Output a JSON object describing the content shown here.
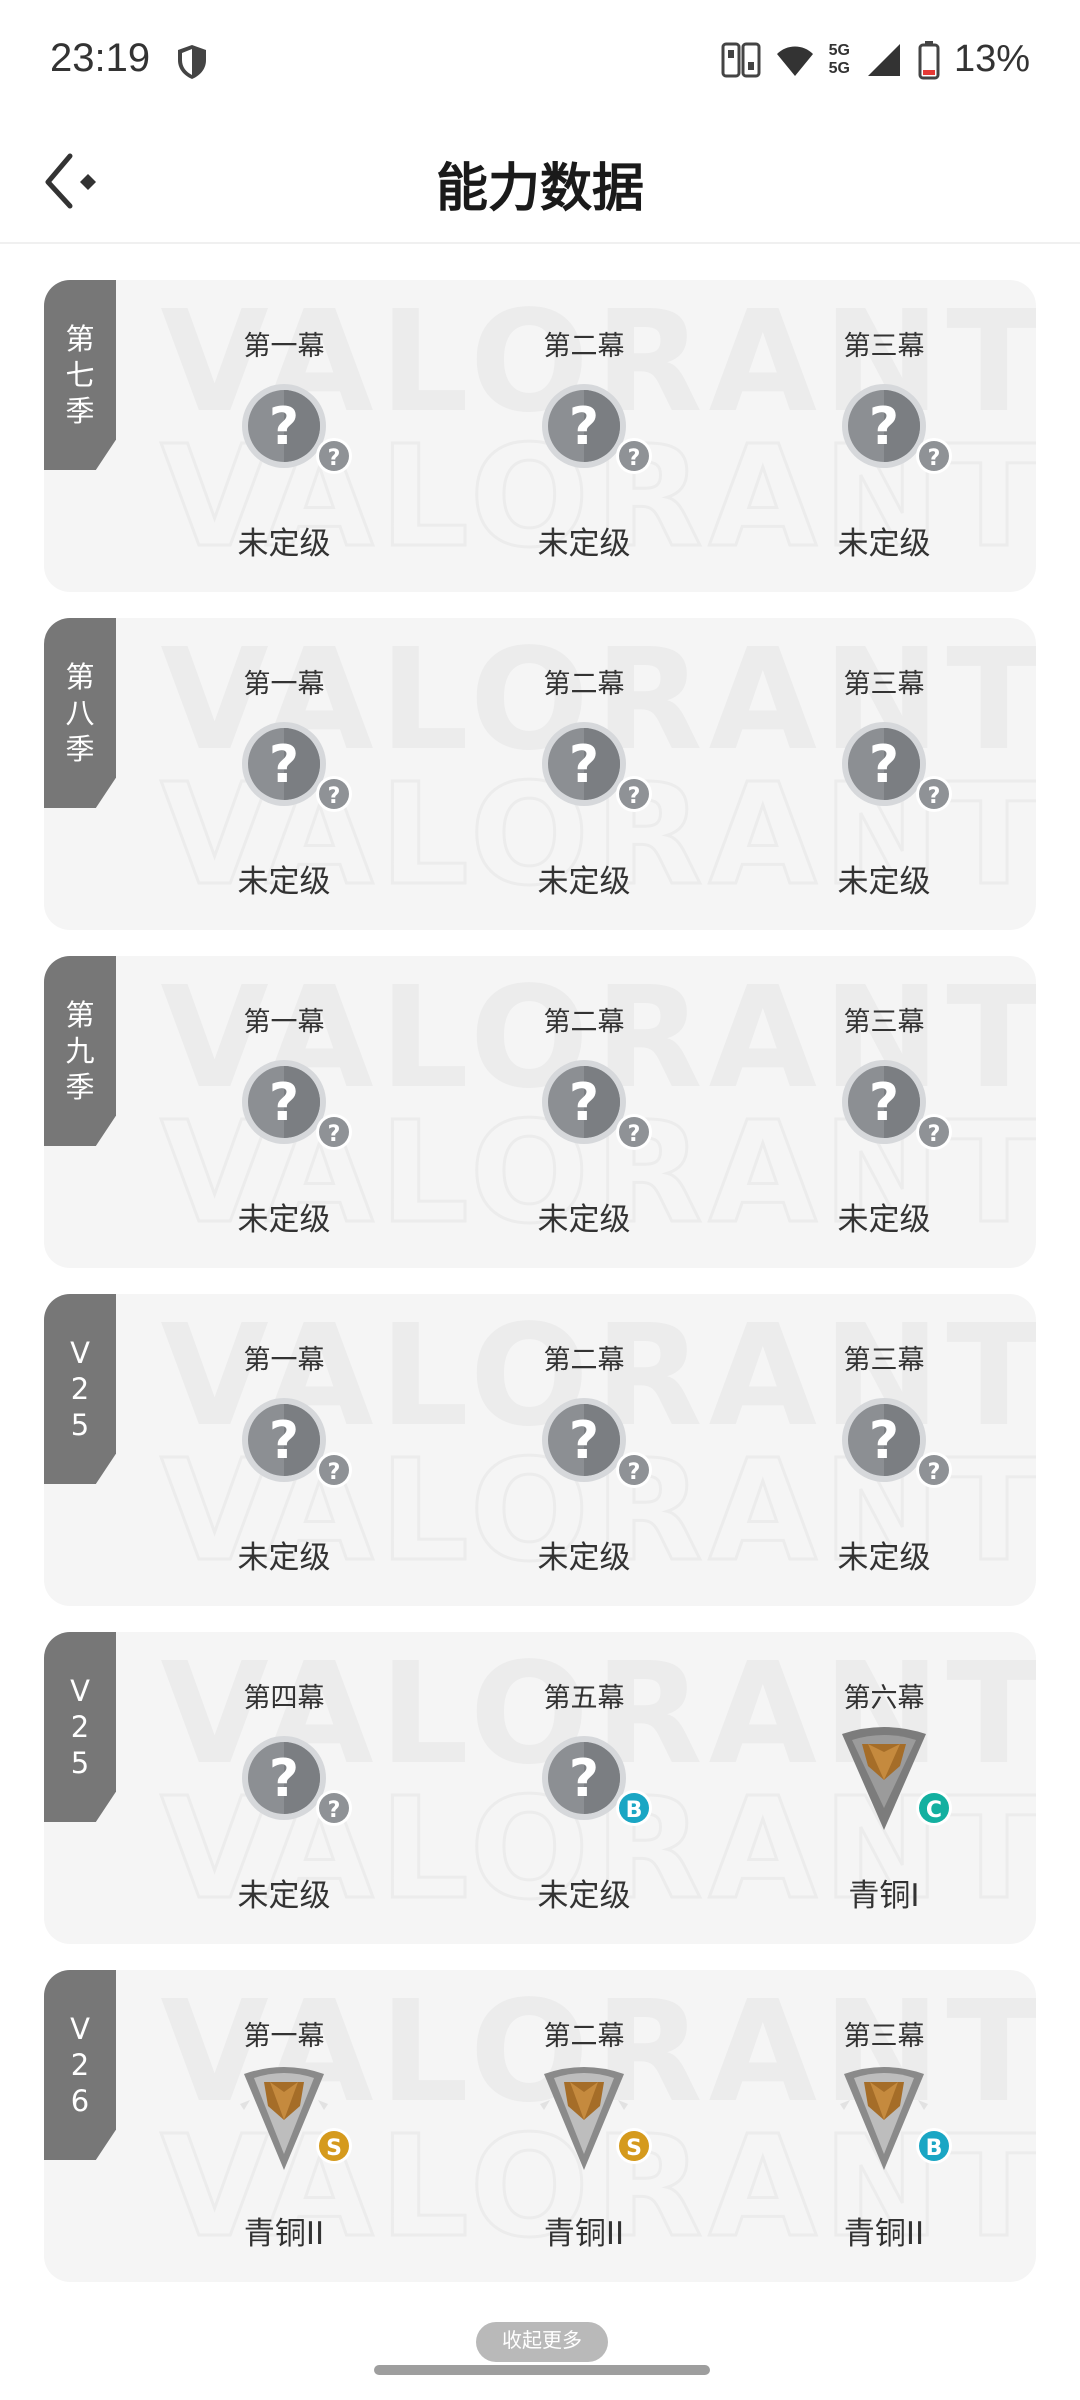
{
  "status_bar": {
    "time": "23:19",
    "network": "5G",
    "battery": "13%",
    "icons": [
      "shield-icon",
      "hd-icon",
      "wifi-icon",
      "signal-icon",
      "battery-icon"
    ]
  },
  "header": {
    "title": "能力数据",
    "back_icon": "back-arrow-icon"
  },
  "watermark_text": "VALORANT",
  "seasons": [
    {
      "tag": "第七季",
      "acts": [
        {
          "name": "第一幕",
          "rank": "未定级",
          "icon": "unranked",
          "grade": "?"
        },
        {
          "name": "第二幕",
          "rank": "未定级",
          "icon": "unranked",
          "grade": "?"
        },
        {
          "name": "第三幕",
          "rank": "未定级",
          "icon": "unranked",
          "grade": "?"
        }
      ]
    },
    {
      "tag": "第八季",
      "acts": [
        {
          "name": "第一幕",
          "rank": "未定级",
          "icon": "unranked",
          "grade": "?"
        },
        {
          "name": "第二幕",
          "rank": "未定级",
          "icon": "unranked",
          "grade": "?"
        },
        {
          "name": "第三幕",
          "rank": "未定级",
          "icon": "unranked",
          "grade": "?"
        }
      ]
    },
    {
      "tag": "第九季",
      "acts": [
        {
          "name": "第一幕",
          "rank": "未定级",
          "icon": "unranked",
          "grade": "?"
        },
        {
          "name": "第二幕",
          "rank": "未定级",
          "icon": "unranked",
          "grade": "?"
        },
        {
          "name": "第三幕",
          "rank": "未定级",
          "icon": "unranked",
          "grade": "?"
        }
      ]
    },
    {
      "tag": "V25",
      "acts": [
        {
          "name": "第一幕",
          "rank": "未定级",
          "icon": "unranked",
          "grade": "?"
        },
        {
          "name": "第二幕",
          "rank": "未定级",
          "icon": "unranked",
          "grade": "?"
        },
        {
          "name": "第三幕",
          "rank": "未定级",
          "icon": "unranked",
          "grade": "?"
        }
      ]
    },
    {
      "tag": "V25",
      "acts": [
        {
          "name": "第四幕",
          "rank": "未定级",
          "icon": "unranked",
          "grade": "?"
        },
        {
          "name": "第五幕",
          "rank": "未定级",
          "icon": "unranked",
          "grade": "B"
        },
        {
          "name": "第六幕",
          "rank": "青铜I",
          "icon": "bronze1",
          "grade": "C"
        }
      ]
    },
    {
      "tag": "V26",
      "acts": [
        {
          "name": "第一幕",
          "rank": "青铜II",
          "icon": "bronze2",
          "grade": "S"
        },
        {
          "name": "第二幕",
          "rank": "青铜II",
          "icon": "bronze2",
          "grade": "S"
        },
        {
          "name": "第三幕",
          "rank": "青铜II",
          "icon": "bronze2",
          "grade": "B"
        }
      ]
    }
  ],
  "collapse_label": "收起更多",
  "colors": {
    "tag_bg": "#777777",
    "card_bg": "#f5f5f5",
    "unranked_grey": "#8c8f93",
    "bronze": "#a56d28",
    "grade_unknown": "#8f9296",
    "grade_b": "#1aa6c4",
    "grade_c": "#13b0a0",
    "grade_s": "#d59a1d"
  }
}
